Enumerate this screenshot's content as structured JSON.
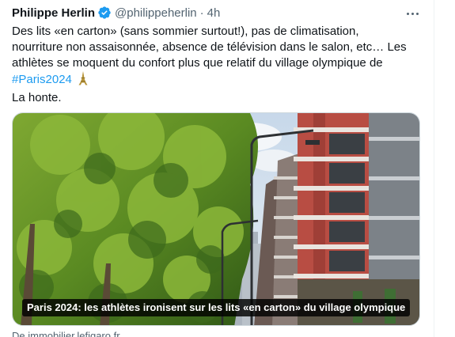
{
  "tweet": {
    "author_name": "Philippe Herlin",
    "handle": "@philippeherlin",
    "separator": "·",
    "time": "4h",
    "text_lines": [
      "Des lits «en carton» (sans sommier surtout!), pas de climatisation,",
      "nourriture non assaisonnée, absence de télévision dans le salon, etc… Les",
      "athlètes se moquent du confort plus que relatif du village olympique de"
    ],
    "hashtag": "#Paris2024",
    "last_line": "La honte.",
    "icons": {
      "verified": "verified-badge-icon",
      "more": "more-options-icon",
      "emoji": "eiffel-tower-emoji-icon"
    }
  },
  "card": {
    "caption": "Paris 2024: les athlètes ironisent sur les lits «en carton» du village olympique",
    "source": "De immobilier.lefigaro.fr"
  },
  "colors": {
    "link": "#1d9bf0",
    "secondary_text": "#536471",
    "verified": "#1d9bf0"
  }
}
